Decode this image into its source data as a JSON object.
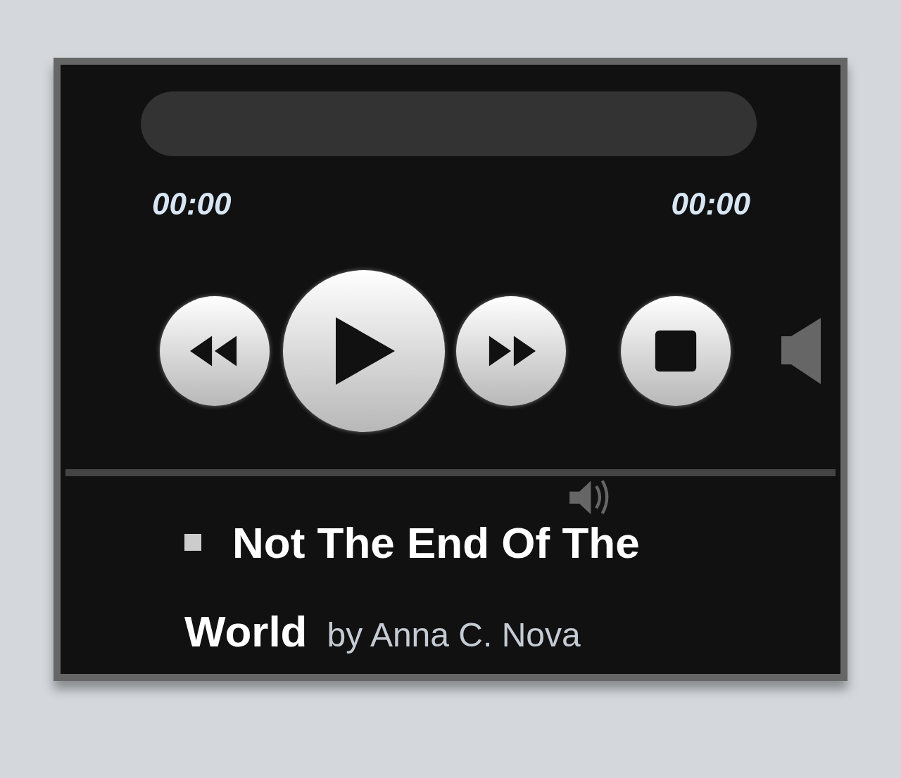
{
  "player": {
    "time_elapsed": "00:00",
    "time_total": "00:00",
    "controls": [
      {
        "kind": "rewind"
      },
      {
        "kind": "play"
      },
      {
        "kind": "forward"
      },
      {
        "kind": "stop"
      }
    ],
    "playlist": [
      {
        "title": "Not The End Of The World",
        "artist": "by Anna C. Nova"
      }
    ]
  }
}
